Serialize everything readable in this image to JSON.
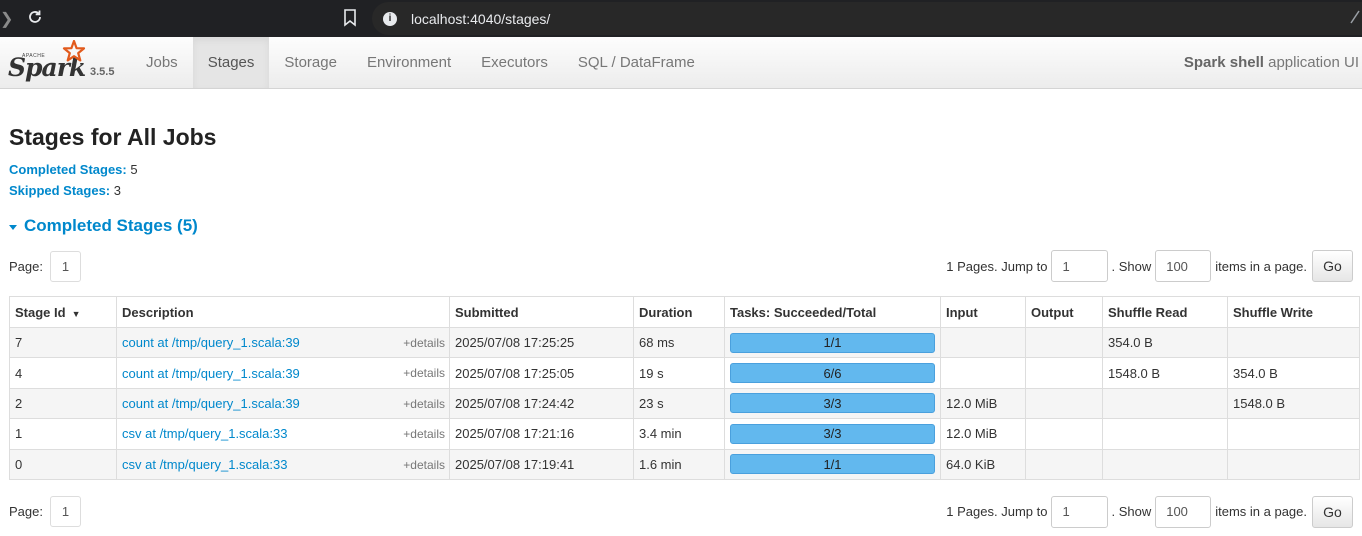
{
  "browser": {
    "url": "localhost:4040/stages/"
  },
  "navbar": {
    "logo_brand": "Spark",
    "logo_apache": "APACHE",
    "version": "3.5.5",
    "tabs": [
      {
        "label": "Jobs"
      },
      {
        "label": "Stages"
      },
      {
        "label": "Storage"
      },
      {
        "label": "Environment"
      },
      {
        "label": "Executors"
      },
      {
        "label": "SQL / DataFrame"
      }
    ],
    "app_name_bold": "Spark shell",
    "app_name_rest": " application UI"
  },
  "page": {
    "title": "Stages for All Jobs",
    "completed_label": "Completed Stages:",
    "completed_count": "5",
    "skipped_label": "Skipped Stages:",
    "skipped_count": "3",
    "section_title": "Completed Stages (5)"
  },
  "pager": {
    "page_label": "Page:",
    "current_page": "1",
    "pages_text": "1 Pages. Jump to",
    "jump_value": "1",
    "show_text": ". Show",
    "show_value": "100",
    "items_text": "items in a page.",
    "go_label": "Go"
  },
  "table": {
    "headers": [
      "Stage Id",
      "Description",
      "Submitted",
      "Duration",
      "Tasks: Succeeded/Total",
      "Input",
      "Output",
      "Shuffle Read",
      "Shuffle Write"
    ],
    "sort_indicator": "▼",
    "details_label": "+details",
    "rows": [
      {
        "id": "7",
        "desc": "count at /tmp/query_1.scala:39",
        "submitted": "2025/07/08 17:25:25",
        "duration": "68 ms",
        "tasks": "1/1",
        "tasks_fraction": 1.0,
        "input": "",
        "output": "",
        "shuffle_read": "354.0 B",
        "shuffle_write": ""
      },
      {
        "id": "4",
        "desc": "count at /tmp/query_1.scala:39",
        "submitted": "2025/07/08 17:25:05",
        "duration": "19 s",
        "tasks": "6/6",
        "tasks_fraction": 1.0,
        "input": "",
        "output": "",
        "shuffle_read": "1548.0 B",
        "shuffle_write": "354.0 B"
      },
      {
        "id": "2",
        "desc": "count at /tmp/query_1.scala:39",
        "submitted": "2025/07/08 17:24:42",
        "duration": "23 s",
        "tasks": "3/3",
        "tasks_fraction": 1.0,
        "input": "12.0 MiB",
        "output": "",
        "shuffle_read": "",
        "shuffle_write": "1548.0 B"
      },
      {
        "id": "1",
        "desc": "csv at /tmp/query_1.scala:33",
        "submitted": "2025/07/08 17:21:16",
        "duration": "3.4 min",
        "tasks": "3/3",
        "tasks_fraction": 1.0,
        "input": "12.0 MiB",
        "output": "",
        "shuffle_read": "",
        "shuffle_write": ""
      },
      {
        "id": "0",
        "desc": "csv at /tmp/query_1.scala:33",
        "submitted": "2025/07/08 17:19:41",
        "duration": "1.6 min",
        "tasks": "1/1",
        "tasks_fraction": 1.0,
        "input": "64.0 KiB",
        "output": "",
        "shuffle_read": "",
        "shuffle_write": ""
      }
    ]
  }
}
